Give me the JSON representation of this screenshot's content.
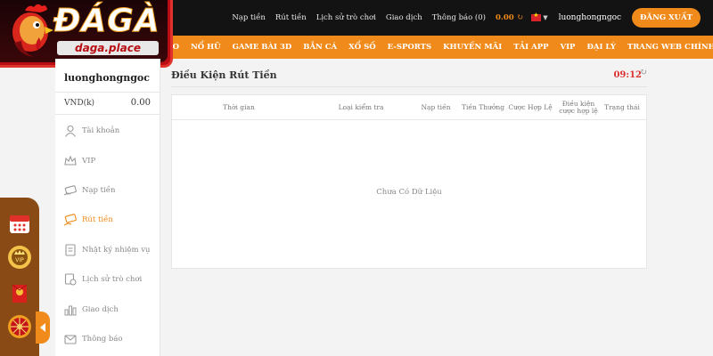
{
  "logo": {
    "title": "ĐÁGÀ",
    "subtitle": "daga.place"
  },
  "topnav": {
    "deposit": "Nạp tiền",
    "withdraw": "Rút tiền",
    "game_history": "Lịch sử trò chơi",
    "transactions": "Giao dịch",
    "notifications": "Thông báo (0)",
    "balance": "0.00",
    "username": "luonghongngoc",
    "logout": "ĐĂNG XUẤT"
  },
  "menu": [
    {
      "label": "AO"
    },
    {
      "label": "NỔ HŨ"
    },
    {
      "label": "GAME BÀI 3D"
    },
    {
      "label": "BẮN CÁ"
    },
    {
      "label": "XỔ SỐ"
    },
    {
      "label": "E-SPORTS"
    },
    {
      "label": "KHUYẾN MÃI"
    },
    {
      "label": "TẢI APP"
    },
    {
      "label": "VIP"
    },
    {
      "label": "ĐẠI LÝ"
    },
    {
      "label": "TRANG WEB CHÍNH THỨC"
    }
  ],
  "sidebar": {
    "username": "luonghongngoc",
    "currency": "VND(k)",
    "amount": "0.00",
    "items": [
      {
        "label": "Tài khoản",
        "icon": "user-icon"
      },
      {
        "label": "VIP",
        "icon": "crown-icon"
      },
      {
        "label": "Nạp tiền",
        "icon": "deposit-icon"
      },
      {
        "label": "Rút tiền",
        "icon": "withdraw-icon",
        "active": true
      },
      {
        "label": "Nhật ký nhiệm vụ",
        "icon": "task-log-icon"
      },
      {
        "label": "Lịch sử trò chơi",
        "icon": "game-history-icon"
      },
      {
        "label": "Giao dịch",
        "icon": "transactions-icon"
      },
      {
        "label": "Thông báo",
        "icon": "mail-icon"
      }
    ]
  },
  "main": {
    "title": "Điều Kiện Rút Tiền",
    "time": "09:12",
    "columns": [
      "Thời gian",
      "Loại kiểm tra",
      "Nạp tiền",
      "Tiền Thưởng",
      "Cược Hợp Lệ",
      "Điều kiện cược hợp lệ",
      "Trạng thái"
    ],
    "empty_text": "Chưa Có Dữ Liệu"
  },
  "colors": {
    "accent": "#f08a1a",
    "topbar": "#131313",
    "logo_red": "#b80d12",
    "time_red": "#dd3333"
  }
}
